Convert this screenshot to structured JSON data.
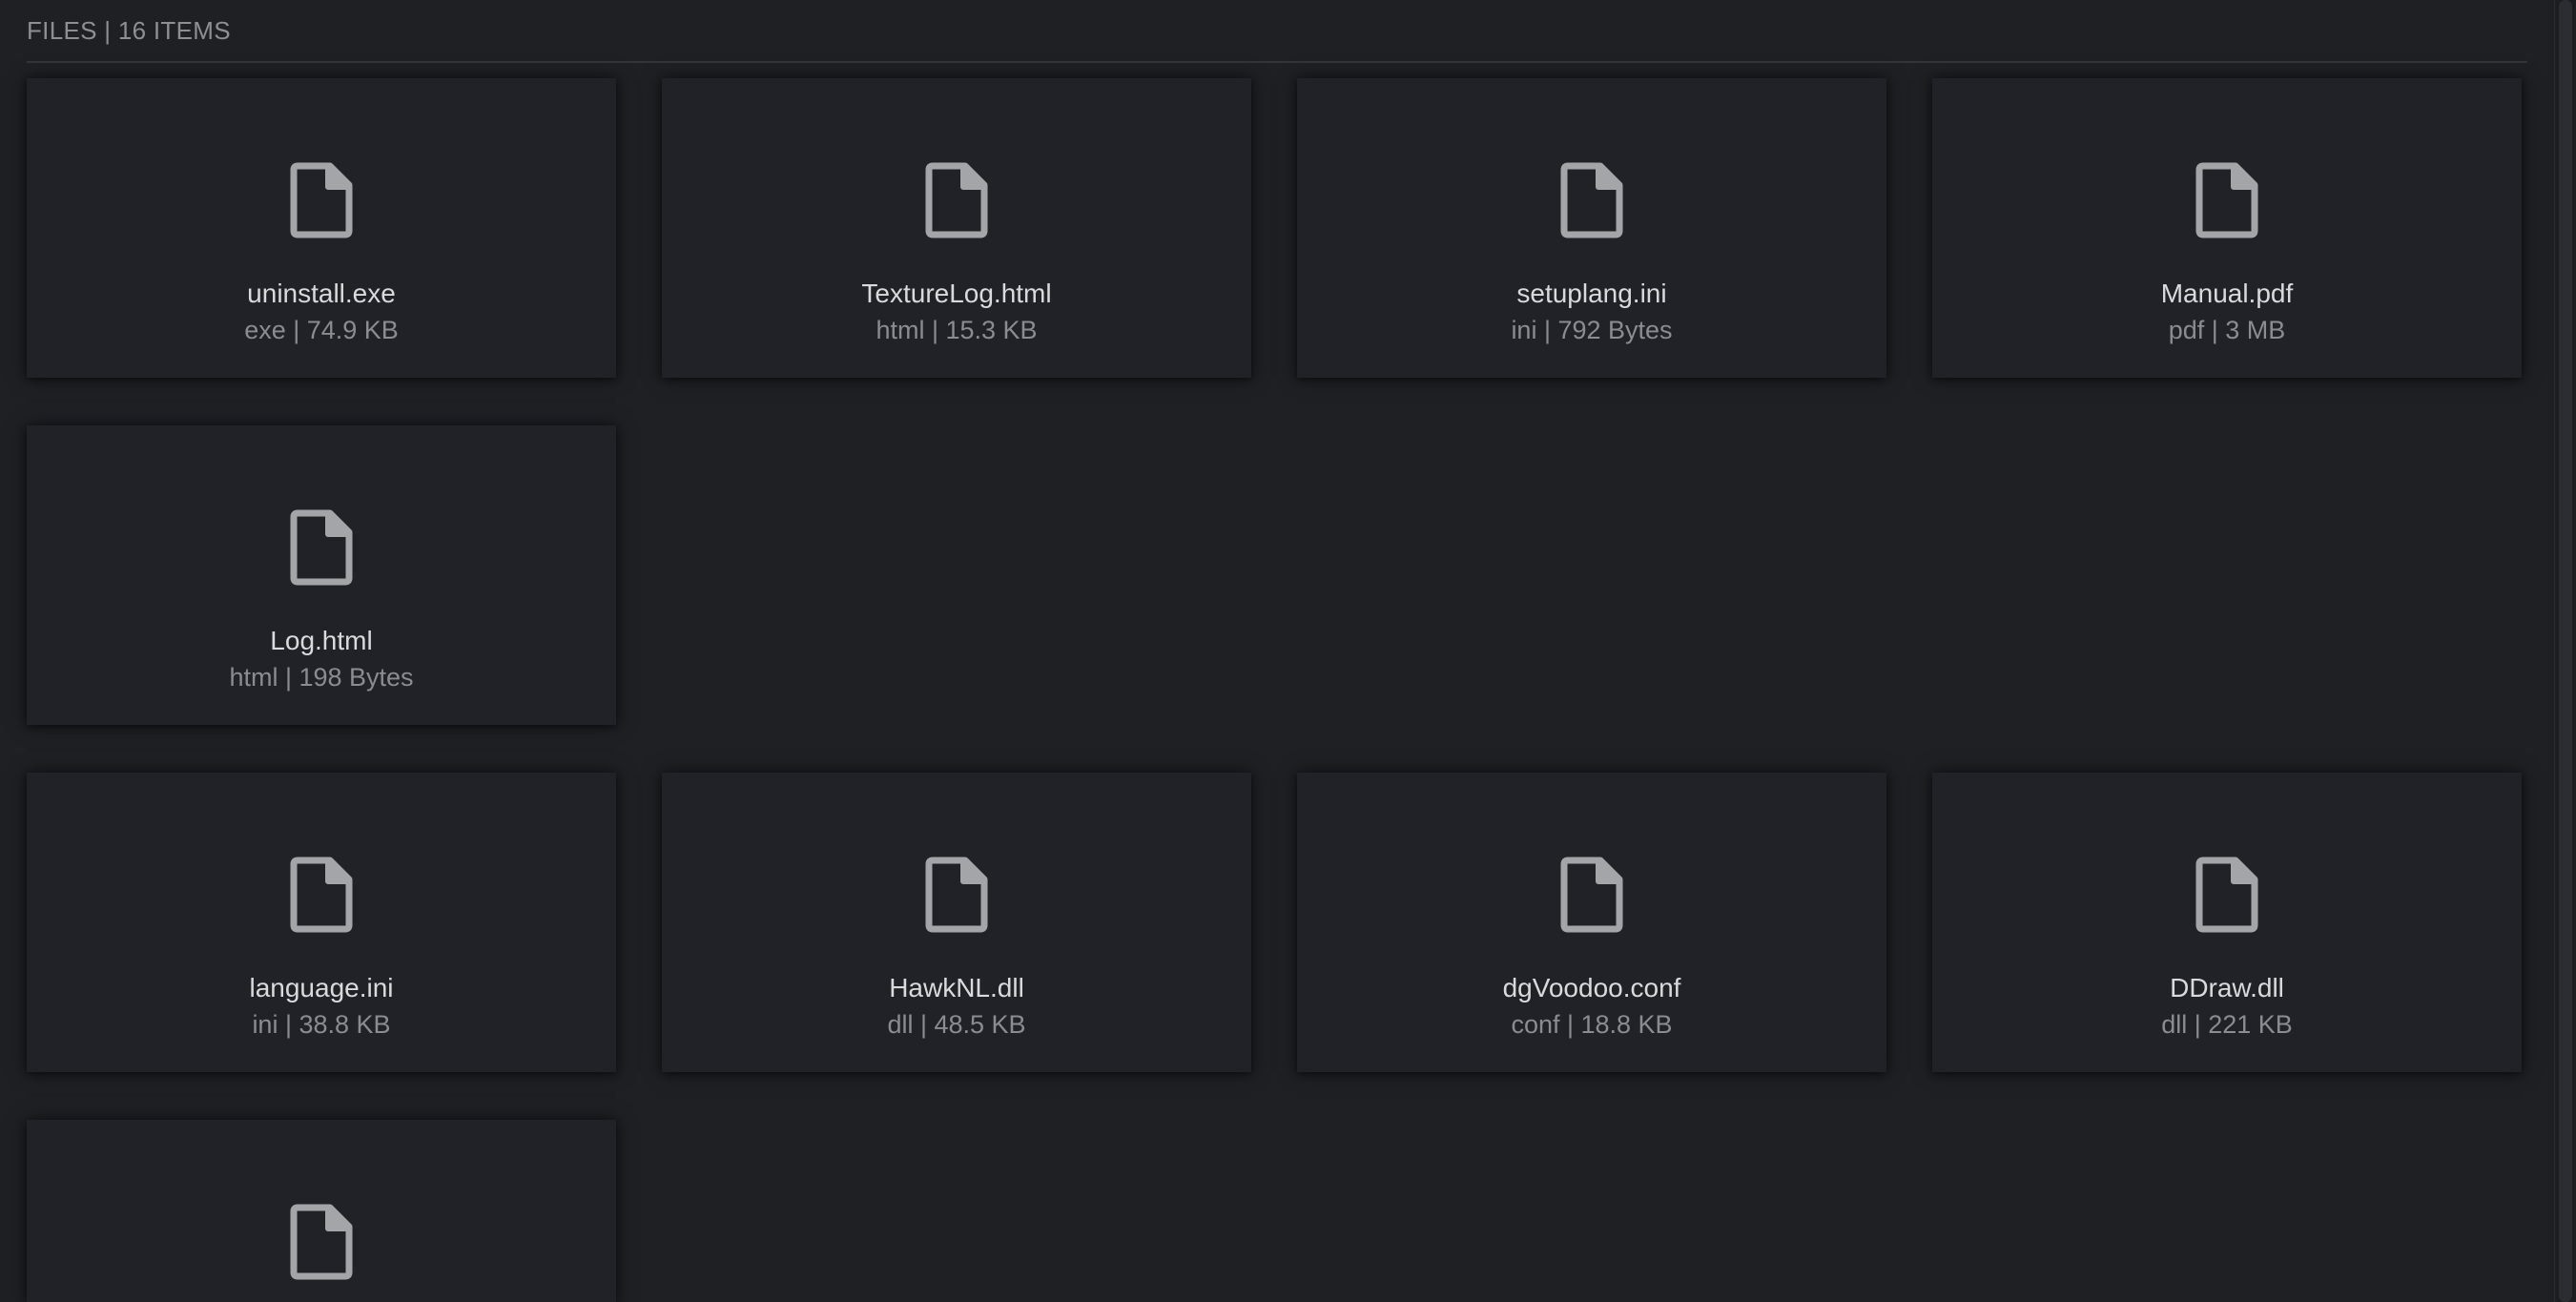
{
  "header": {
    "title": "FILES | 16 ITEMS"
  },
  "rows": [
    [
      {
        "name": "uninstall.exe",
        "meta": "exe | 74.9 KB",
        "icon": "file-icon"
      },
      {
        "name": "TextureLog.html",
        "meta": "html | 15.3 KB",
        "icon": "file-icon"
      },
      {
        "name": "setuplang.ini",
        "meta": "ini | 792 Bytes",
        "icon": "file-icon"
      },
      {
        "name": "Manual.pdf",
        "meta": "pdf | 3 MB",
        "icon": "file-icon"
      }
    ],
    [
      {
        "name": "Log.html",
        "meta": "html | 198 Bytes",
        "icon": "file-icon"
      }
    ],
    [
      {
        "name": "language.ini",
        "meta": "ini | 38.8 KB",
        "icon": "file-icon"
      },
      {
        "name": "HawkNL.dll",
        "meta": "dll | 48.5 KB",
        "icon": "file-icon"
      },
      {
        "name": "dgVoodoo.conf",
        "meta": "conf | 18.8 KB",
        "icon": "file-icon"
      },
      {
        "name": "DDraw.dll",
        "meta": "dll | 221 KB",
        "icon": "file-icon"
      }
    ],
    [
      {
        "icon": "file-icon"
      }
    ]
  ],
  "colors": {
    "background": "#1f2024",
    "card": "#212227",
    "icon": "#a4a5a9",
    "name_text": "#d9dadd",
    "meta_text": "#8a8c92"
  }
}
